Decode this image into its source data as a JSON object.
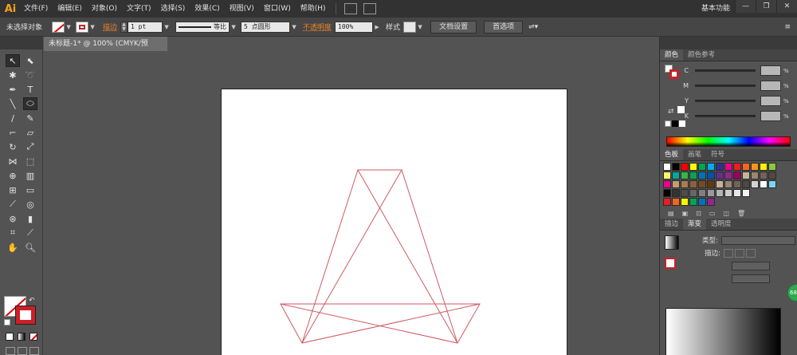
{
  "app": {
    "logo": "Ai",
    "workspace": "基本功能"
  },
  "menu": [
    "文件(F)",
    "编辑(E)",
    "对象(O)",
    "文字(T)",
    "选择(S)",
    "效果(C)",
    "视图(V)",
    "窗口(W)",
    "帮助(H)"
  ],
  "window_controls": {
    "minimize": "—",
    "restore": "❐",
    "close": "✕"
  },
  "control_bar": {
    "selection": "未选择对象",
    "stroke_label": "描边",
    "stroke_weight": "1 pt",
    "line_profile": "等比",
    "brush": "5 点圆形",
    "opacity_label": "不透明度",
    "opacity_value": "100%",
    "style_label": "样式",
    "doc_setup": "文档设置",
    "preferences": "首选项"
  },
  "document": {
    "tab_title": "未标题-1* @ 100% (CMYK/预览)",
    "close": "✕"
  },
  "color_panel": {
    "tabs": [
      "颜色",
      "颜色参考"
    ],
    "channels": [
      {
        "name": "C",
        "unit": "%"
      },
      {
        "name": "M",
        "unit": "%"
      },
      {
        "name": "Y",
        "unit": "%"
      },
      {
        "name": "K",
        "unit": "%"
      }
    ]
  },
  "swatches_panel": {
    "tabs": [
      "色板",
      "画笔",
      "符号"
    ],
    "rows": [
      [
        "#ffffff",
        "#000000",
        "#ff0000",
        "#ffff00",
        "#00a651",
        "#00aeef",
        "#2e3192",
        "#ec008c",
        "#ed1c24",
        "#f26522",
        "#f7941d",
        "#fff200",
        "#8dc63f"
      ],
      [
        "#fff568",
        "#00a99d",
        "#39b54a",
        "#00a651",
        "#0072bc",
        "#0054a6",
        "#662d91",
        "#92278f",
        "#9e005d",
        "#c2b59b",
        "#998675",
        "#736357",
        "#534741"
      ],
      [
        "#ec008c",
        "#c69c6d",
        "#a67c52",
        "#8c6239",
        "#754c24",
        "#603913",
        "#c7b299",
        "#998675",
        "#736357",
        "#534741",
        "#d2d2d2",
        "#ffffff",
        "#7dd3f7"
      ],
      [
        "#000000",
        "#333333",
        "#4d4d4d",
        "#666666",
        "#808080",
        "#999999",
        "#b3b3b3",
        "#cccccc",
        "#e6e6e6",
        "#f2f2f2"
      ],
      [
        "#ed1c24",
        "#f26522",
        "#fff200",
        "#00a651",
        "#0072bc",
        "#92278f"
      ]
    ]
  },
  "gradient_panel": {
    "tabs": [
      "描边",
      "渐变",
      "透明度"
    ],
    "type_label": "类型:",
    "stroke_label": "描边:"
  },
  "badge": "68"
}
